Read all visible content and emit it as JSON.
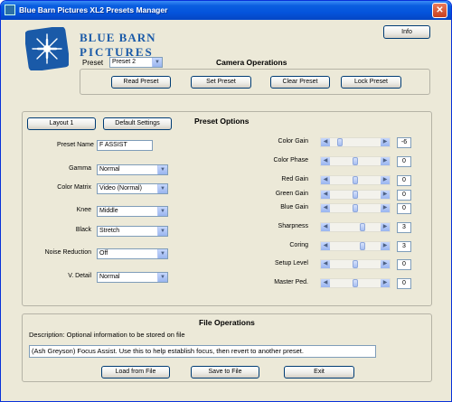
{
  "window": {
    "title": "Blue Barn Pictures XL2 Presets Manager",
    "close_glyph": "✕"
  },
  "header": {
    "logo_line1": "BLUE BARN",
    "logo_line2": "PICTURES",
    "info_label": "Info",
    "preset_label": "Preset",
    "preset_value": "Preset 2",
    "camera_ops_title": "Camera Operations",
    "read_preset": "Read Preset",
    "set_preset": "Set Preset",
    "clear_preset": "Clear Preset",
    "lock_preset": "Lock Preset"
  },
  "preset_options": {
    "title": "Preset Options",
    "layout_button": "Layout 1",
    "default_settings_button": "Default Settings",
    "preset_name_label": "Preset Name",
    "preset_name_value": "F ASSIST",
    "combos": [
      {
        "label": "Gamma",
        "value": "Normal"
      },
      {
        "label": "Color Matrix",
        "value": "Video (Normal)"
      },
      {
        "label": "Knee",
        "value": "Middle"
      },
      {
        "label": "Black",
        "value": "Stretch"
      },
      {
        "label": "Noise Reduction",
        "value": "Off"
      },
      {
        "label": "V. Detail",
        "value": "Normal"
      }
    ],
    "sliders": [
      {
        "label": "Color Gain",
        "value": "-6",
        "min": -9,
        "max": 9,
        "level": -6
      },
      {
        "label": "Color Phase",
        "value": "0",
        "min": -9,
        "max": 9,
        "level": 0
      },
      {
        "label": "Red Gain",
        "value": "0",
        "min": -9,
        "max": 9,
        "level": 0
      },
      {
        "label": "Green Gain",
        "value": "0",
        "min": -9,
        "max": 9,
        "level": 0
      },
      {
        "label": "Blue Gain",
        "value": "0",
        "min": -9,
        "max": 9,
        "level": 0
      },
      {
        "label": "Sharpness",
        "value": "3",
        "min": -9,
        "max": 9,
        "level": 3
      },
      {
        "label": "Coring",
        "value": "3",
        "min": -9,
        "max": 9,
        "level": 3
      },
      {
        "label": "Setup Level",
        "value": "0",
        "min": -9,
        "max": 9,
        "level": 0
      },
      {
        "label": "Master Ped.",
        "value": "0",
        "min": -9,
        "max": 9,
        "level": 0
      }
    ]
  },
  "file_ops": {
    "title": "File Operations",
    "description_label": "Description: Optional information to be stored on file",
    "description_value": "(Ash Greyson) Focus Assist. Use this to help establish focus, then revert to another preset.",
    "load_button": "Load from File",
    "save_button": "Save to File",
    "exit_button": "Exit"
  },
  "colors": {
    "titlebar": "#0454dc",
    "window_bg": "#ece9d8",
    "logo_blue": "#1a5aa8"
  }
}
